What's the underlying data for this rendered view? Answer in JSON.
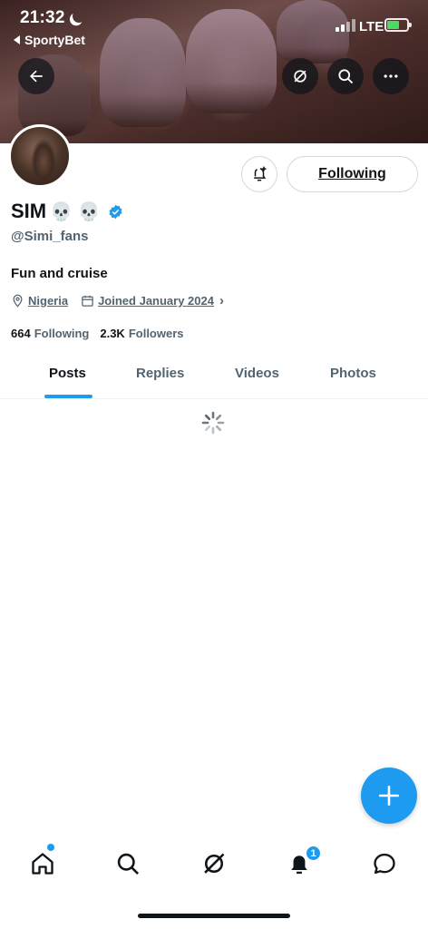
{
  "status_bar": {
    "time": "21:32",
    "back_app": "SportyBet",
    "network": "LTE"
  },
  "banner": {
    "buttons": [
      "back-arrow-icon",
      "grok-icon",
      "search-icon",
      "more-icon"
    ]
  },
  "profile": {
    "display_name": "SIM",
    "emoji": "💀 💀",
    "handle": "@Simi_fans",
    "bio": "Fun and cruise",
    "location": "Nigeria",
    "joined": "Joined January 2024",
    "following_count": "664",
    "following_label": "Following",
    "followers_count": "2.3K",
    "followers_label": "Followers",
    "follow_button": "Following"
  },
  "tabs": [
    "Posts",
    "Replies",
    "Videos",
    "Photos"
  ],
  "active_tab": "Posts",
  "nav": {
    "items": [
      "home-icon",
      "search-icon",
      "grok-icon",
      "notifications-icon",
      "messages-icon"
    ],
    "notification_count": "1"
  },
  "colors": {
    "accent": "#1d9bf0",
    "text": "#0f1419",
    "muted": "#536471"
  }
}
